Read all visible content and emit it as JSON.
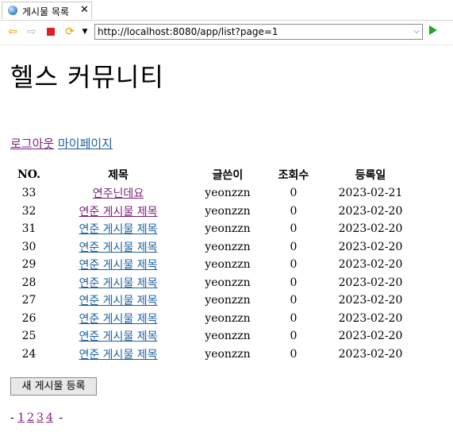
{
  "browser": {
    "tab_title": "게시물 목록",
    "url": "http://localhost:8080/app/list?page=1"
  },
  "page": {
    "title": "헬스 커뮤니티",
    "logout_link": "로그아웃",
    "mypage_link": "마이페이지"
  },
  "table": {
    "headers": [
      "NO.",
      "제목",
      "글쓴이",
      "조회수",
      "등록일"
    ],
    "rows": [
      {
        "no": "33",
        "title": "연주닌데요",
        "author": "yeonzzn",
        "views": "0",
        "date": "2023-02-21"
      },
      {
        "no": "32",
        "title": "연준 게시물 제목",
        "author": "yeonzzn",
        "views": "0",
        "date": "2023-02-20"
      },
      {
        "no": "31",
        "title": "연준 게시물 제목",
        "author": "yeonzzn",
        "views": "0",
        "date": "2023-02-20"
      },
      {
        "no": "30",
        "title": "연준 게시물 제목",
        "author": "yeonzzn",
        "views": "0",
        "date": "2023-02-20"
      },
      {
        "no": "29",
        "title": "연준 게시물 제목",
        "author": "yeonzzn",
        "views": "0",
        "date": "2023-02-20"
      },
      {
        "no": "28",
        "title": "연준 게시물 제목",
        "author": "yeonzzn",
        "views": "0",
        "date": "2023-02-20"
      },
      {
        "no": "27",
        "title": "연준 게시물 제목",
        "author": "yeonzzn",
        "views": "0",
        "date": "2023-02-20"
      },
      {
        "no": "26",
        "title": "연준 게시물 제목",
        "author": "yeonzzn",
        "views": "0",
        "date": "2023-02-20"
      },
      {
        "no": "25",
        "title": "연준 게시물 제목",
        "author": "yeonzzn",
        "views": "0",
        "date": "2023-02-20"
      },
      {
        "no": "24",
        "title": "연준 게시물 제목",
        "author": "yeonzzn",
        "views": "0",
        "date": "2023-02-20"
      }
    ]
  },
  "new_post_button": "새 게시물 등록",
  "pager": {
    "prefix": "-",
    "pages": [
      "1",
      "2",
      "3",
      "4"
    ],
    "suffix": "-"
  }
}
